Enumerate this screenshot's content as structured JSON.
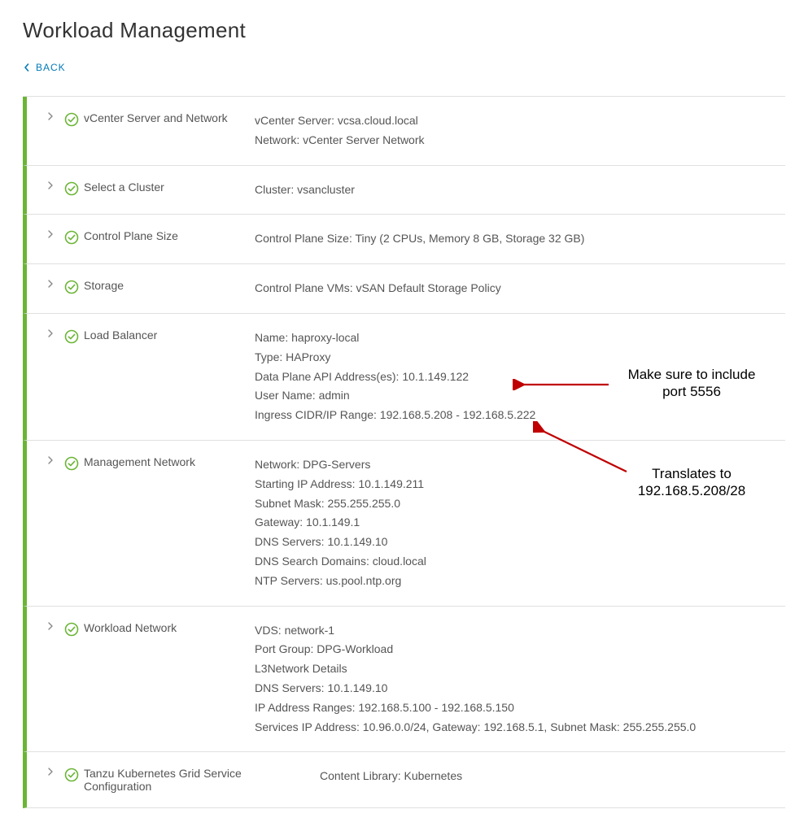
{
  "title": "Workload Management",
  "back_label": "BACK",
  "steps": [
    {
      "label": "vCenter Server and Network",
      "lines": [
        "vCenter Server: vcsa.cloud.local",
        "Network: vCenter Server Network"
      ]
    },
    {
      "label": "Select a Cluster",
      "lines": [
        "Cluster: vsancluster"
      ]
    },
    {
      "label": "Control Plane Size",
      "lines": [
        "Control Plane Size: Tiny (2 CPUs, Memory 8 GB, Storage 32 GB)"
      ]
    },
    {
      "label": "Storage",
      "lines": [
        "Control Plane VMs: vSAN Default Storage Policy"
      ]
    },
    {
      "label": "Load Balancer",
      "lines": [
        "Name: haproxy-local",
        "Type: HAProxy",
        "Data Plane API Address(es): 10.1.149.122",
        "User Name: admin",
        "Ingress CIDR/IP Range: 192.168.5.208 - 192.168.5.222"
      ]
    },
    {
      "label": "Management Network",
      "lines": [
        "Network: DPG-Servers",
        "Starting IP Address: 10.1.149.211",
        "Subnet Mask: 255.255.255.0",
        "Gateway: 10.1.149.1",
        "DNS Servers: 10.1.149.10",
        "DNS Search Domains: cloud.local",
        "NTP Servers: us.pool.ntp.org"
      ]
    },
    {
      "label": "Workload Network",
      "lines": [
        "VDS: network-1",
        "Port Group: DPG-Workload",
        "L3Network Details",
        "DNS Servers: 10.1.149.10",
        "IP Address Ranges: 192.168.5.100 - 192.168.5.150",
        "Services IP Address: 10.96.0.0/24, Gateway: 192.168.5.1, Subnet Mask: 255.255.255.0"
      ]
    },
    {
      "label": "Tanzu Kubernetes Grid Service Configuration",
      "lines": [
        "Content Library: Kubernetes"
      ]
    }
  ],
  "annotations": {
    "port_note_line1": "Make sure to include",
    "port_note_line2": "port 5556",
    "cidr_note_line1": "Translates to",
    "cidr_note_line2": "192.168.5.208/28"
  }
}
